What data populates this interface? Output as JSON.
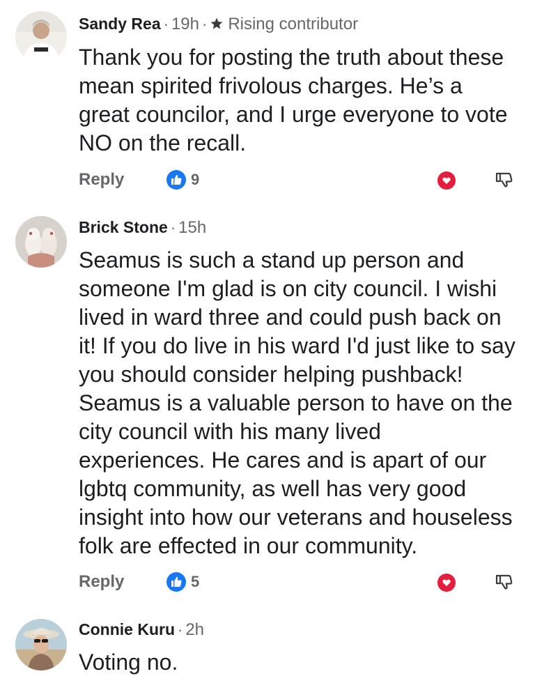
{
  "comments": [
    {
      "author": "Sandy Rea",
      "time": "19h",
      "badge": "Rising contributor",
      "text": "Thank you for posting the truth about these\nmean spirited frivolous charges.  He’s a\ngreat councilor, and I urge everyone to vote\nNO on the recall.",
      "reply_label": "Reply",
      "like_count": "9"
    },
    {
      "author": "Brick Stone",
      "time": "15h",
      "text": "Seamus is such a stand up person and\nsomeone I'm glad is on city council. I wishi\nlived in ward three and could push back on\nit! If you do live in his ward I'd just like to say\nyou should consider helping pushback!\nSeamus is a valuable person to have on the\ncity council with his many lived\nexperiences. He cares and is apart of our\nlgbtq community, as well has very good\ninsight into how our veterans and houseless\nfolk are effected in our community.",
      "reply_label": "Reply",
      "like_count": "5"
    },
    {
      "author": "Connie Kuru",
      "time": "2h",
      "text": "Voting no."
    }
  ],
  "separator": "·",
  "icons": {
    "like": "thumbs-up-icon",
    "heart": "heart-icon",
    "dislike": "thumbs-down-icon",
    "badge": "star-icon"
  },
  "colors": {
    "like_blue": "#1877f2",
    "heart_red": "#e41e3f",
    "meta_gray": "#65676b",
    "text": "#1c1e21"
  }
}
